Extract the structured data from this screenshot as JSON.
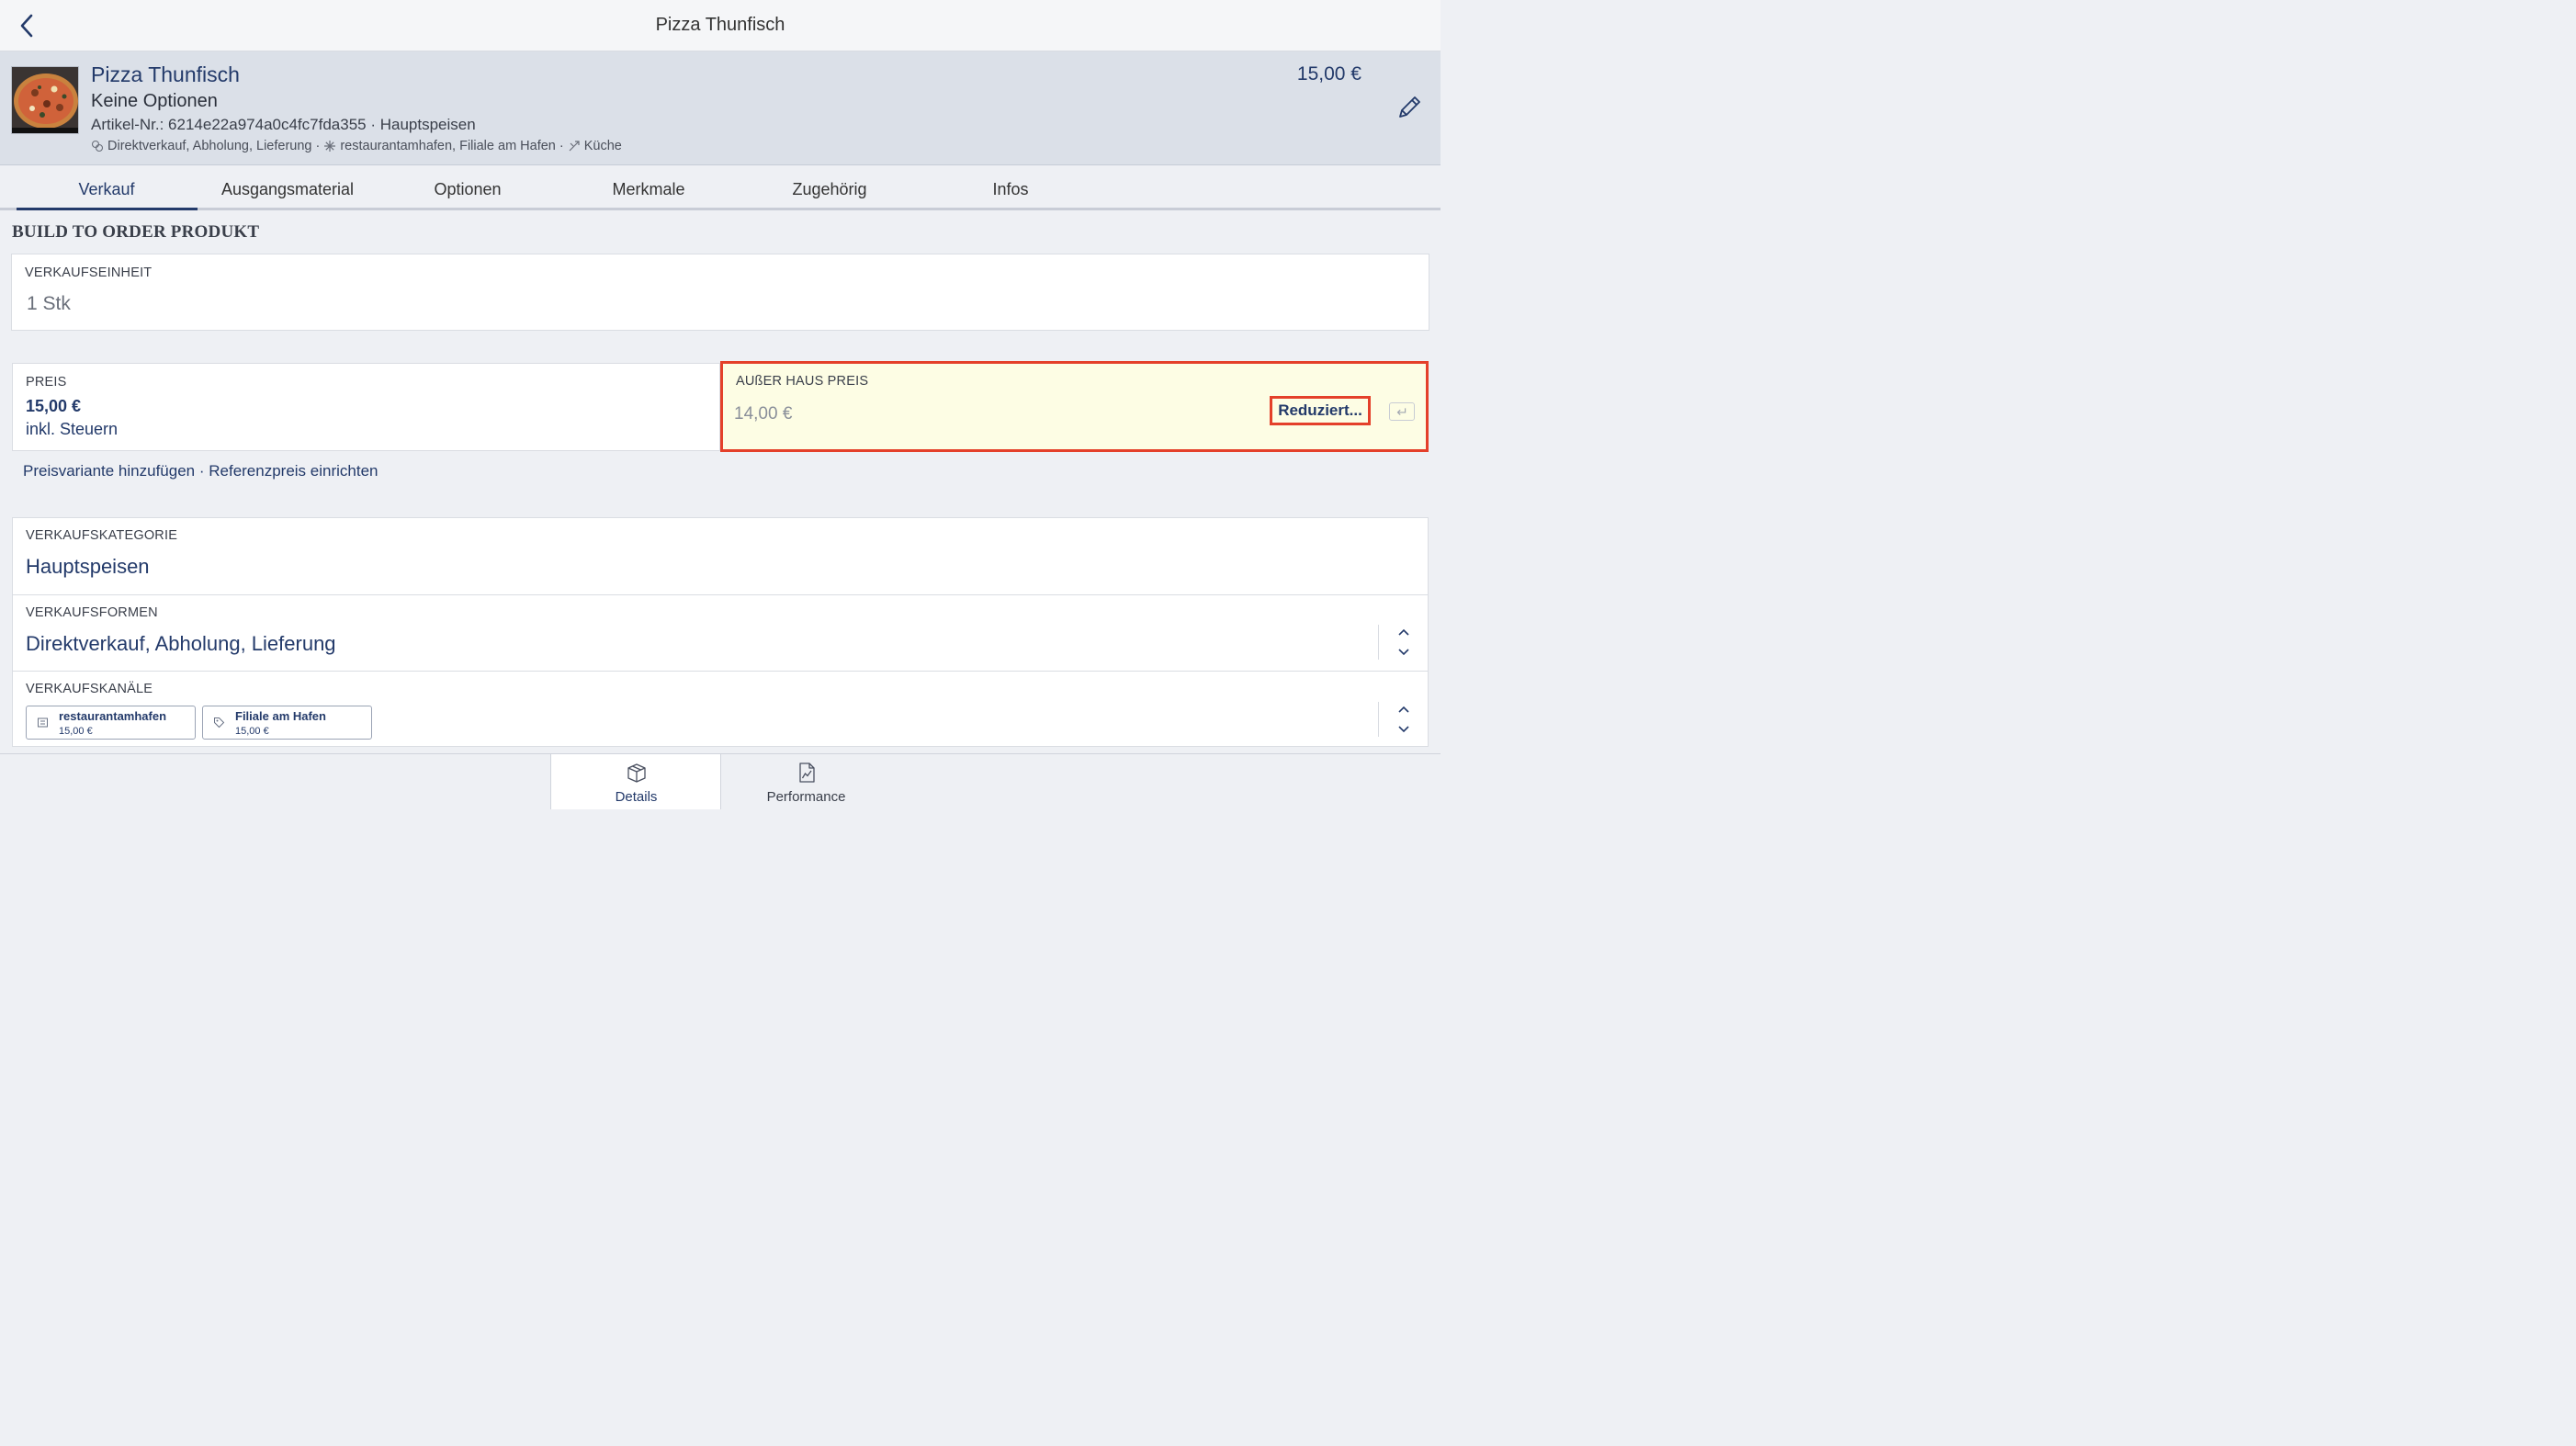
{
  "topbar": {
    "title": "Pizza Thunfisch"
  },
  "product": {
    "name": "Pizza Thunfisch",
    "options": "Keine Optionen",
    "article": "Artikel-Nr.: 6214e22a974a0c4fc7fda355 · Hauptspeisen",
    "meta_forms": "Direktverkauf, Abholung, Lieferung ·",
    "meta_channels": "restaurantamhafen, Filiale am Hafen ·",
    "meta_kitchen": "Küche",
    "price": "15,00 €"
  },
  "tabs": [
    {
      "label": "Verkauf"
    },
    {
      "label": "Ausgangsmaterial"
    },
    {
      "label": "Optionen"
    },
    {
      "label": "Merkmale"
    },
    {
      "label": "Zugehörig"
    },
    {
      "label": "Infos"
    }
  ],
  "section_title": "BUILD TO ORDER PRODUKT",
  "unit": {
    "label": "VERKAUFSEINHEIT",
    "value": "1 Stk"
  },
  "price": {
    "label": "PREIS",
    "value": "15,00 €",
    "tax": "inkl. Steuern"
  },
  "takeaway": {
    "label": "AUßER HAUS PREIS",
    "value": "14,00 €",
    "button": "Reduziert..."
  },
  "links": {
    "add_variant": "Preisvariante hinzufügen",
    "separator": " · ",
    "reference": "Referenzpreis einrichten"
  },
  "category": {
    "label": "VERKAUFSKATEGORIE",
    "value": "Hauptspeisen"
  },
  "forms": {
    "label": "VERKAUFSFORMEN",
    "value": "Direktverkauf, Abholung, Lieferung"
  },
  "channels": {
    "label": "VERKAUFSKANÄLE",
    "items": [
      {
        "name": "restaurantamhafen",
        "price": "15,00 €"
      },
      {
        "name": "Filiale am Hafen",
        "price": "15,00 €"
      }
    ]
  },
  "bottom_tabs": [
    {
      "label": "Details"
    },
    {
      "label": "Performance"
    }
  ],
  "colors": {
    "accent": "#233a6a",
    "highlight": "#e4402a",
    "takeaway_bg": "#fdfde4"
  }
}
